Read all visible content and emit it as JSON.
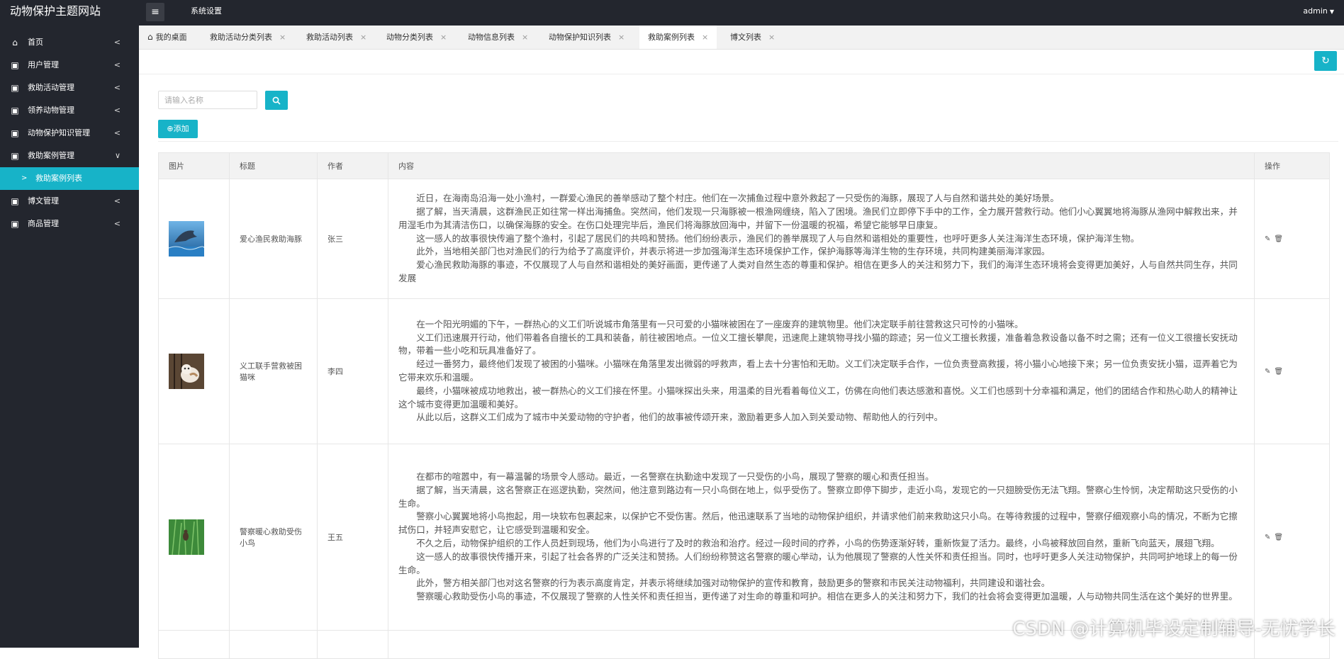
{
  "app": {
    "title": "动物保护主题网站"
  },
  "header": {
    "menu_icon": "menu-icon",
    "system_settings": "系统设置",
    "user": "admin"
  },
  "sidebar": {
    "items": [
      {
        "label": "首页",
        "icon": "home-icon"
      },
      {
        "label": "用户管理",
        "icon": "lock-icon"
      },
      {
        "label": "救助活动管理",
        "icon": "lock-icon"
      },
      {
        "label": "领养动物管理",
        "icon": "lock-icon"
      },
      {
        "label": "动物保护知识管理",
        "icon": "lock-icon"
      },
      {
        "label": "救助案例管理",
        "icon": "lock-icon"
      },
      {
        "label": "博文管理",
        "icon": "lock-icon"
      },
      {
        "label": "商品管理",
        "icon": "lock-icon"
      }
    ],
    "active_sub": "救助案例列表"
  },
  "tabs": [
    {
      "label": "我的桌面"
    },
    {
      "label": "救助活动分类列表"
    },
    {
      "label": "救助活动列表"
    },
    {
      "label": "动物分类列表"
    },
    {
      "label": "动物信息列表"
    },
    {
      "label": "动物保护知识列表"
    },
    {
      "label": "救助案例列表"
    },
    {
      "label": "博文列表"
    }
  ],
  "search": {
    "placeholder": "请输入名称"
  },
  "add_label": "添加",
  "colors": {
    "accent": "#17b3c8",
    "sidebar_bg": "#23262e"
  },
  "table": {
    "headers": [
      "图片",
      "标题",
      "作者",
      "内容",
      "操作"
    ],
    "rows": [
      {
        "image": "dolphin-photo",
        "title": "爱心渔民救助海豚",
        "author": "张三",
        "paragraphs": [
          "近日，在海南岛沿海一处小渔村，一群爱心渔民的善举感动了整个村庄。他们在一次捕鱼过程中意外救起了一只受伤的海豚，展现了人与自然和谐共处的美好场景。",
          "据了解，当天清晨，这群渔民正如往常一样出海捕鱼。突然间，他们发现一只海豚被一根渔网缠绕，陷入了困境。渔民们立即停下手中的工作，全力展开营救行动。他们小心翼翼地将海豚从渔网中解救出来，并用湿毛巾为其清洁伤口，以确保海豚的安全。在伤口处理完毕后，渔民们将海豚放回海中，并留下一份温暖的祝福，希望它能够早日康复。",
          "这一感人的故事很快传遍了整个渔村，引起了居民们的共鸣和赞扬。他们纷纷表示，渔民们的善举展现了人与自然和谐相处的重要性，也呼吁更多人关注海洋生态环境，保护海洋生物。",
          "此外，当地相关部门也对渔民们的行为给予了高度评价，并表示将进一步加强海洋生态环境保护工作，保护海豚等海洋生物的生存环境，共同构建美丽海洋家园。",
          "爱心渔民救助海豚的事迹，不仅展现了人与自然和谐相处的美好画面，更传递了人类对自然生态的尊重和保护。相信在更多人的关注和努力下，我们的海洋生态环境将会变得更加美好，人与自然共同生存，共同发展"
        ]
      },
      {
        "image": "kitten-photo",
        "title": "义工联手营救被困猫咪",
        "author": "李四",
        "paragraphs": [
          "在一个阳光明媚的下午，一群热心的义工们听说城市角落里有一只可爱的小猫咪被困在了一座废弃的建筑物里。他们决定联手前往营救这只可怜的小猫咪。",
          "义工们迅速展开行动，他们带着各自擅长的工具和装备，前往被困地点。一位义工擅长攀爬，迅速爬上建筑物寻找小猫的踪迹；另一位义工擅长救援，准备着急救设备以备不时之需；还有一位义工很擅长安抚动物，带着一些小吃和玩具准备好了。",
          "经过一番努力，最终他们发现了被困的小猫咪。小猫咪在角落里发出微弱的呼救声，看上去十分害怕和无助。义工们决定联手合作，一位负责登高救援，将小猫小心地接下来；另一位负责安抚小猫，逗弄着它为它带来欢乐和温暖。",
          "最终，小猫咪被成功地救出，被一群热心的义工们接在怀里。小猫咪探出头来，用温柔的目光看着每位义工，仿佛在向他们表达感激和喜悦。义工们也感到十分幸福和满足，他们的团结合作和热心助人的精神让这个城市变得更加温暖和美好。",
          "从此以后，这群义工们成为了城市中关爱动物的守护者，他们的故事被传颂开来，激励着更多人加入到关爱动物、帮助他人的行列中。"
        ]
      },
      {
        "image": "bird-photo",
        "title": "警察暖心救助受伤小鸟",
        "author": "王五",
        "paragraphs": [
          "在都市的喧嚣中，有一幕温馨的场景令人感动。最近，一名警察在执勤途中发现了一只受伤的小鸟，展现了警察的暖心和责任担当。",
          "据了解，当天清晨，这名警察正在巡逻执勤，突然间，他注意到路边有一只小鸟倒在地上，似乎受伤了。警察立即停下脚步，走近小鸟，发现它的一只翅膀受伤无法飞翔。警察心生怜悯，决定帮助这只受伤的小生命。",
          "警察小心翼翼地将小鸟抱起，用一块软布包裹起来，以保护它不受伤害。然后，他迅速联系了当地的动物保护组织，并请求他们前来救助这只小鸟。在等待救援的过程中，警察仔细观察小鸟的情况，不断为它擦拭伤口，并轻声安慰它，让它感受到温暖和安全。",
          "不久之后，动物保护组织的工作人员赶到现场，他们为小鸟进行了及时的救治和治疗。经过一段时间的疗养，小鸟的伤势逐渐好转，重新恢复了活力。最终，小鸟被释放回自然，重新飞向蓝天，展翅飞翔。",
          "这一感人的故事很快传播开来，引起了社会各界的广泛关注和赞扬。人们纷纷称赞这名警察的暖心举动，认为他展现了警察的人性关怀和责任担当。同时，也呼吁更多人关注动物保护，共同呵护地球上的每一份生命。",
          "此外，警方相关部门也对这名警察的行为表示高度肯定，并表示将继续加强对动物保护的宣传和教育，鼓励更多的警察和市民关注动物福利，共同建设和谐社会。",
          "警察暖心救助受伤小鸟的事迹，不仅展现了警察的人性关怀和责任担当，更传递了对生命的尊重和呵护。相信在更多人的关注和努力下，我们的社会将会变得更加温暖，人与动物共同生活在这个美好的世界里。"
        ]
      }
    ]
  },
  "watermark": "CSDN @计算机毕设定制辅导-无忧学长"
}
